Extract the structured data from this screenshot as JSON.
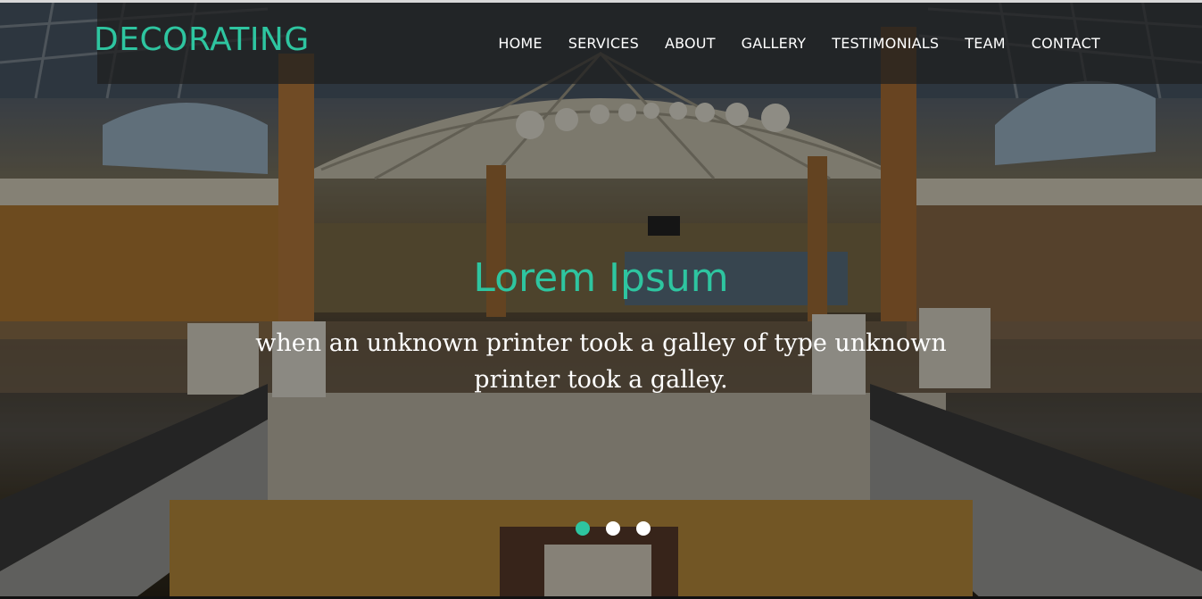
{
  "header": {
    "brand": "DECORATING",
    "nav": [
      {
        "label": "HOME"
      },
      {
        "label": "SERVICES"
      },
      {
        "label": "ABOUT"
      },
      {
        "label": "GALLERY"
      },
      {
        "label": "TESTIMONIALS"
      },
      {
        "label": "TEAM"
      },
      {
        "label": "CONTACT"
      }
    ]
  },
  "hero": {
    "title": "Lorem Ipsum",
    "text": "when an unknown printer took a galley of type unknown printer took a galley.",
    "slides": 3,
    "active_slide": 1
  },
  "colors": {
    "accent": "#2ec5a0",
    "nav_text": "#ffffff",
    "navbar_bg": "rgba(30,30,30,0.72)"
  }
}
